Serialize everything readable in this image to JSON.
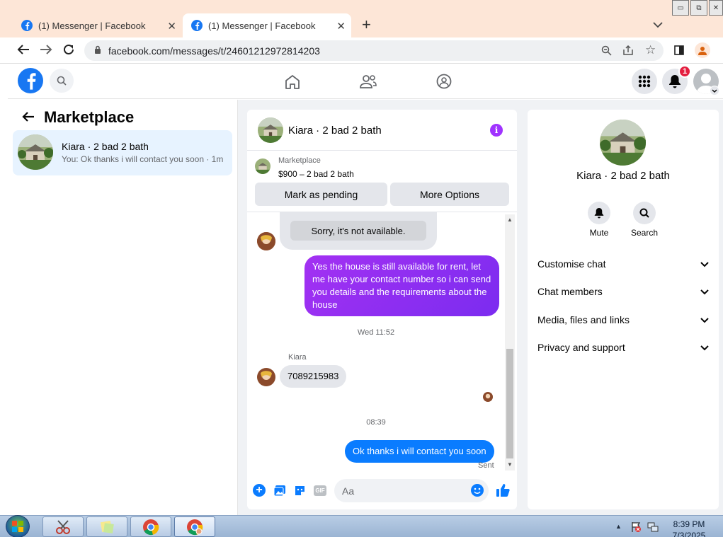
{
  "browser": {
    "tabs": [
      {
        "title": "(1) Messenger | Facebook"
      },
      {
        "title": "(1) Messenger | Facebook"
      }
    ],
    "url": "facebook.com/messages/t/24601212972814203"
  },
  "fb": {
    "notification_count": "1"
  },
  "left": {
    "title": "Marketplace",
    "thread": {
      "name": "Kiara · 2 bad 2 bath",
      "preview": "You: Ok thanks i will contact you soon · 1m"
    }
  },
  "chat": {
    "header_name": "Kiara · 2 bad 2 bath",
    "listing": {
      "label": "Marketplace",
      "price_title": "$900 – 2 bad 2 bath"
    },
    "mark_pending": "Mark as pending",
    "more_options": "More Options",
    "messages": {
      "m1": "Sorry, it's not available.",
      "m2": "Yes the house is still available for rent, let me have your contact number so i can send you details and the requirements about the house",
      "ts1": "Wed 11:52",
      "sender": "Kiara",
      "m3": "7089215983",
      "ts2": "08:39",
      "m4": "Ok thanks i will contact you soon",
      "status": "Sent"
    },
    "composer_placeholder": "Aa"
  },
  "right": {
    "name": "Kiara · 2 bad 2 bath",
    "mute": "Mute",
    "search": "Search",
    "sections": [
      "Customise chat",
      "Chat members",
      "Media, files and links",
      "Privacy and support"
    ]
  },
  "taskbar": {
    "time": "8:39 PM",
    "date": "7/3/2025"
  },
  "colors": {
    "fb_blue": "#1877f2",
    "purple": "#8a2be2",
    "tab_strip": "#fde6d7"
  }
}
